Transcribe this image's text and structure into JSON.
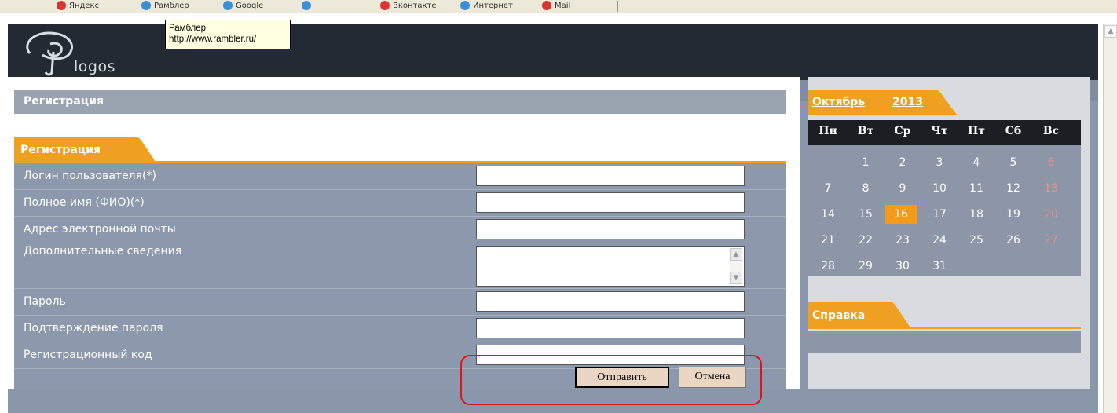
{
  "browser": {
    "toolbar_items": [
      "Яндекс",
      "Рамблер",
      "Google",
      "",
      "Вконтакте",
      "Интернет",
      "Mail"
    ]
  },
  "tooltip": {
    "title": "Рамблер",
    "url": "http://www.rambler.ru/"
  },
  "site": {
    "logo_text": "logos"
  },
  "main": {
    "page_title": "Регистрация",
    "section_tab": "Регистрация"
  },
  "form": {
    "fields": [
      {
        "label": "Логин пользователя(*)",
        "value": ""
      },
      {
        "label": "Полное имя (ФИО)(*)",
        "value": ""
      },
      {
        "label": "Адрес электронной почты",
        "value": ""
      },
      {
        "label": "Дополнительные сведения",
        "value": ""
      },
      {
        "label": "Пароль",
        "value": ""
      },
      {
        "label": "Подтверждение пароля",
        "value": ""
      },
      {
        "label": "Регистрационный код",
        "value": ""
      }
    ],
    "submit_label": "Отправить",
    "cancel_label": "Отмена"
  },
  "calendar": {
    "month": "Октябрь",
    "year": "2013",
    "weekdays": [
      "Пн",
      "Вт",
      "Ср",
      "Чт",
      "Пт",
      "Сб",
      "Вс"
    ],
    "today": "16",
    "weeks": [
      [
        "",
        "1",
        "2",
        "3",
        "4",
        "5",
        "6"
      ],
      [
        "7",
        "8",
        "9",
        "10",
        "11",
        "12",
        "13"
      ],
      [
        "14",
        "15",
        "16",
        "17",
        "18",
        "19",
        "20"
      ],
      [
        "21",
        "22",
        "23",
        "24",
        "25",
        "26",
        "27"
      ],
      [
        "28",
        "29",
        "30",
        "31",
        "",
        "",
        ""
      ]
    ]
  },
  "help": {
    "title": "Справка"
  },
  "colors": {
    "accent": "#f0a020",
    "header": "#242a33",
    "highlight": "#d8171b"
  }
}
